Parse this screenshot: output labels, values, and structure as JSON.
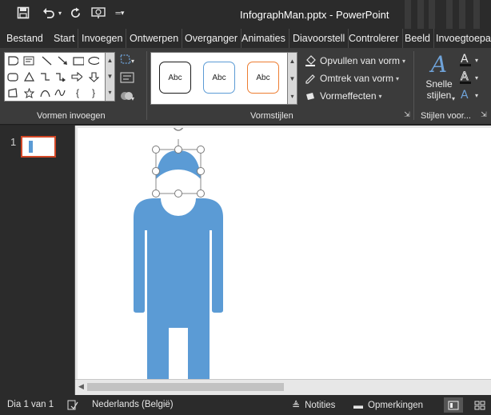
{
  "titlebar": {
    "title": "InfographMan.pptx - PowerPoint",
    "qat": {
      "save_icon": "save-icon",
      "undo_icon": "undo-icon",
      "redo_icon": "repeat-icon",
      "present_icon": "present-from-start-icon",
      "customize_icon": "customize-qat-icon"
    }
  },
  "tabs": [
    "Bestand",
    "Start",
    "Invoegen",
    "Ontwerpen",
    "Overgangen",
    "Animaties",
    "Diavoorstelling",
    "Controleren",
    "Beeld",
    "Invoegtoepassingen"
  ],
  "tabs_visible": [
    "Bestand",
    "Start",
    "Invoegen",
    "Ontwerpen",
    "Overganger",
    "Animaties",
    "Diavoorstell",
    "Controlerer",
    "Beeld",
    "Invoegtoepa"
  ],
  "ribbon": {
    "groups": {
      "insert_shapes": "Vormen invoegen",
      "shape_styles": "Vormstijlen",
      "wordart_styles": "Stijlen voor..."
    },
    "style_samples": [
      {
        "label": "Abc",
        "border": "#1a1a1a"
      },
      {
        "label": "Abc",
        "border": "#5b9bd5"
      },
      {
        "label": "Abc",
        "border": "#ed7d31"
      }
    ],
    "fill_label": "Opvullen van vorm",
    "outline_label": "Omtrek van vorm",
    "effects_label": "Vormeffecten",
    "quick_styles_line1": "Snelle",
    "quick_styles_line2": "stijlen"
  },
  "slides": {
    "number": "1"
  },
  "statusbar": {
    "slide_info": "Dia 1 van 1",
    "language": "Nederlands (België)",
    "notes": "Notities",
    "comments": "Opmerkingen"
  },
  "colors": {
    "figure": "#5b9bd5",
    "accent": "#d24726",
    "ribbon": "#3b3b3b",
    "titlebar": "#2b2b2b"
  }
}
